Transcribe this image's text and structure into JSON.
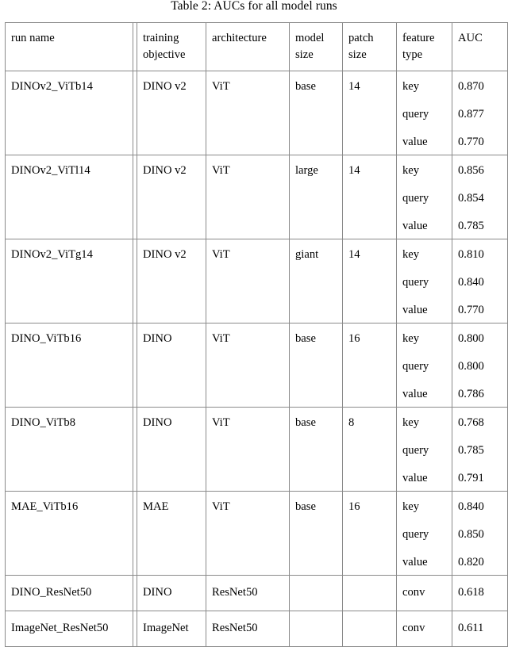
{
  "caption": "Table 2: AUCs for all model runs",
  "table": {
    "columns": [
      {
        "key": "run_name",
        "label": "run name"
      },
      {
        "key": "training_objective",
        "label": "training objective"
      },
      {
        "key": "architecture",
        "label": "architecture"
      },
      {
        "key": "model_size",
        "label": "model size"
      },
      {
        "key": "patch_size",
        "label": "patch size"
      },
      {
        "key": "feature_type",
        "label": "feature type"
      },
      {
        "key": "auc",
        "label": "AUC"
      }
    ],
    "header_labels": {
      "run_name": "run name",
      "training_objective_line1": "training",
      "training_objective_line2": "objective",
      "architecture": "architecture",
      "model_size_line1": "model",
      "model_size_line2": "size",
      "patch_size_line1": "patch",
      "patch_size_line2": "size",
      "feature_type_line1": "feature",
      "feature_type_line2": "type",
      "auc": "AUC"
    },
    "rows": [
      {
        "run_name": "DINOv2_ViTb14",
        "training_objective": "DINO v2",
        "architecture": "ViT",
        "model_size": "base",
        "patch_size": "14",
        "features": [
          {
            "feature_type": "key",
            "auc": "0.870"
          },
          {
            "feature_type": "query",
            "auc": "0.877"
          },
          {
            "feature_type": "value",
            "auc": "0.770"
          }
        ]
      },
      {
        "run_name": "DINOv2_ViTl14",
        "training_objective": "DINO v2",
        "architecture": "ViT",
        "model_size": "large",
        "patch_size": "14",
        "features": [
          {
            "feature_type": "key",
            "auc": "0.856"
          },
          {
            "feature_type": "query",
            "auc": "0.854"
          },
          {
            "feature_type": "value",
            "auc": "0.785"
          }
        ]
      },
      {
        "run_name": "DINOv2_ViTg14",
        "training_objective": "DINO v2",
        "architecture": "ViT",
        "model_size": "giant",
        "patch_size": "14",
        "features": [
          {
            "feature_type": "key",
            "auc": "0.810"
          },
          {
            "feature_type": "query",
            "auc": "0.840"
          },
          {
            "feature_type": "value",
            "auc": "0.770"
          }
        ]
      },
      {
        "run_name": "DINO_ViTb16",
        "training_objective": "DINO",
        "architecture": "ViT",
        "model_size": "base",
        "patch_size": "16",
        "features": [
          {
            "feature_type": "key",
            "auc": "0.800"
          },
          {
            "feature_type": "query",
            "auc": "0.800"
          },
          {
            "feature_type": "value",
            "auc": "0.786"
          }
        ]
      },
      {
        "run_name": "DINO_ViTb8",
        "training_objective": "DINO",
        "architecture": "ViT",
        "model_size": "base",
        "patch_size": "8",
        "features": [
          {
            "feature_type": "key",
            "auc": "0.768"
          },
          {
            "feature_type": "query",
            "auc": "0.785"
          },
          {
            "feature_type": "value",
            "auc": "0.791"
          }
        ]
      },
      {
        "run_name": "MAE_ViTb16",
        "training_objective": "MAE",
        "architecture": "ViT",
        "model_size": "base",
        "patch_size": "16",
        "features": [
          {
            "feature_type": "key",
            "auc": "0.840"
          },
          {
            "feature_type": "query",
            "auc": "0.850"
          },
          {
            "feature_type": "value",
            "auc": "0.820"
          }
        ]
      },
      {
        "run_name": "DINO_ResNet50",
        "training_objective": "DINO",
        "architecture": "ResNet50",
        "model_size": "",
        "patch_size": "",
        "features": [
          {
            "feature_type": "conv",
            "auc": "0.618"
          }
        ]
      },
      {
        "run_name": "ImageNet_ResNet50",
        "training_objective": "ImageNet",
        "architecture": "ResNet50",
        "model_size": "",
        "patch_size": "",
        "features": [
          {
            "feature_type": "conv",
            "auc": "0.611"
          }
        ]
      }
    ]
  },
  "colors": {
    "border": "#8a8a8a",
    "text": "#000000",
    "background": "#ffffff"
  }
}
